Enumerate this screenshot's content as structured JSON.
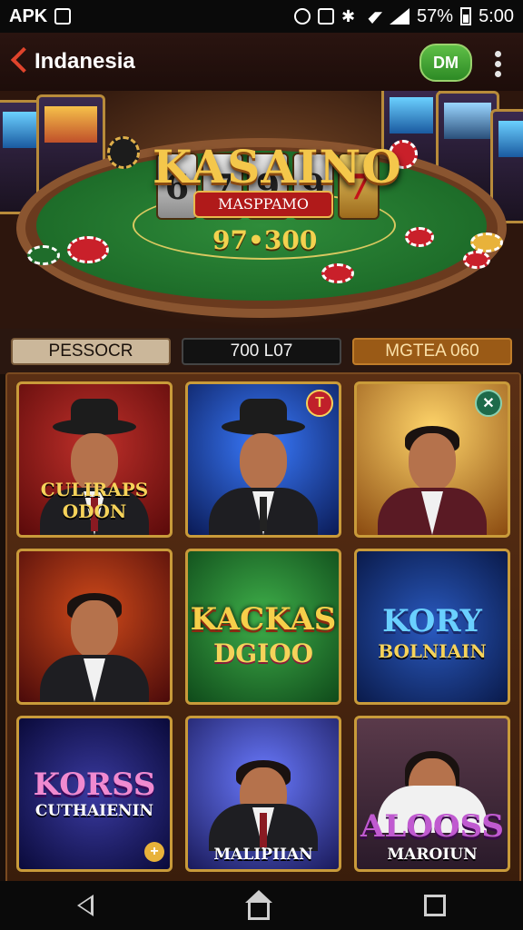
{
  "status_bar": {
    "app_label": "APK",
    "battery": "57%",
    "time": "5:00"
  },
  "header": {
    "location": "Indanesia",
    "dm_button": "DM"
  },
  "banner": {
    "logo": "KASAINO",
    "logo_sub": "MASPPAMO",
    "reels": [
      "6",
      "7",
      "9",
      "9",
      "7"
    ],
    "amount": "97•300"
  },
  "tabs": [
    "PESSOCR",
    "700 L07",
    "MGTEA 060"
  ],
  "cards": [
    {
      "title": "CULIRAPS ODON"
    },
    {
      "title": ""
    },
    {
      "title": ""
    },
    {
      "title": ""
    },
    {
      "title_line1": "KACKAS",
      "title_line2": "DGIOO"
    },
    {
      "title_line1": "KORY",
      "title_line2": "BOLNIAIN"
    },
    {
      "title_line1": "KORSS",
      "title_line2": "CUTHAIENIN"
    },
    {
      "title": "MALIPIIAN"
    },
    {
      "title_line1": "ALOOSS",
      "title_line2": "MAROIUN"
    }
  ]
}
